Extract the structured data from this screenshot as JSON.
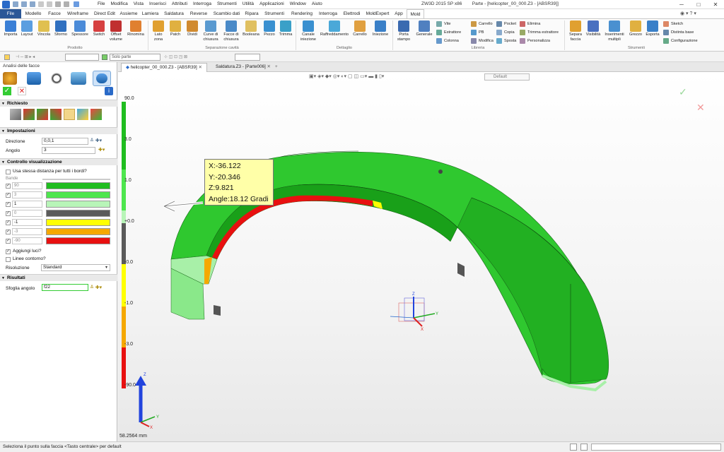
{
  "app": {
    "title": "ZW3D 2015 SP x86",
    "document": "Parte - [helicopter_00_000.Z3 - [ABSR39]]"
  },
  "menu": [
    "File",
    "Modifica",
    "Vista",
    "Inserisci",
    "Attributi",
    "Interroga",
    "Strumenti",
    "Utilità",
    "Applicazioni",
    "Window",
    "Aiuto"
  ],
  "tabs": [
    "File",
    "Modello",
    "Facce",
    "Wireframe",
    "Direct Edit",
    "Assieme",
    "Lamiera",
    "Saldatura",
    "Reverse",
    "Scambio dati",
    "Ripara",
    "Strumenti",
    "Rendering",
    "Interroga",
    "Elettrodi",
    "MoldExpert",
    "App",
    "Mold"
  ],
  "ribbon": {
    "prodotto": [
      "Importa",
      "Layout",
      "Vincola",
      "Sformo",
      "Spessore",
      "Switch",
      "Offset volume",
      "Rinomina"
    ],
    "separazione": [
      "Lato zona",
      "Patch",
      "Dividi",
      "Curve di chiusura",
      "Facce di chiusura",
      "Booleana",
      "Pezzo",
      "Trimma"
    ],
    "dettaglio": [
      "Canale iniezione",
      "Raffreddamento",
      "Carrello",
      "Iniezione"
    ],
    "libreria_big": [
      "Porta stampo",
      "Generale"
    ],
    "libreria_small": [
      "Vite",
      "Estrattore",
      "Colonna",
      "Carrello",
      "PB",
      "Modifica",
      "Pocket",
      "Copia",
      "Sposta",
      "Elimina",
      "Trimma estrattore",
      "Personalizza"
    ],
    "strumenti_big": [
      "Separa faccia",
      "Visibilità",
      "Inserimenti multipli",
      "Grezzo",
      "Esporta"
    ],
    "strumenti_small": [
      "Sketch",
      "Distinta base",
      "Configurazione"
    ],
    "groups": [
      "Prodotto",
      "Separazione cavità",
      "Dettaglio",
      "Libreria",
      "Strumenti"
    ]
  },
  "toolbar": {
    "filter": "Solo parte"
  },
  "panel": {
    "title": "Analisi delle facce",
    "sections": {
      "required": "Richiesto",
      "settings": "Impostazioni",
      "display": "Controllo visualizzazione",
      "results": "Risultati"
    },
    "direction_label": "Direzione",
    "direction_value": "0,0,1",
    "angle_label": "Angolo",
    "angle_value": "3",
    "same_distance": "Usa stessa distanza per tutti i bordi?",
    "bands_label": "Bande",
    "bands": [
      {
        "value": "90",
        "color": "#1fbd1f"
      },
      {
        "value": "3",
        "color": "#4ee64e"
      },
      {
        "value": "1",
        "color": "#b8f5b8"
      },
      {
        "value": "0",
        "color": "#5a5a5a"
      },
      {
        "value": "-1",
        "color": "#ffff00"
      },
      {
        "value": "-3",
        "color": "#f5a800"
      },
      {
        "value": "-90",
        "color": "#e81010"
      }
    ],
    "add_lights": "Aggiungi luci?",
    "contour_lines": "Linee contorno?",
    "resolution_label": "Risoluzione",
    "resolution_value": "Standard",
    "sheet_angle_label": "Sfoglia angolo",
    "sheet_angle_value": "f22"
  },
  "doc_tabs": [
    "helicopter_00_000.Z3 - [ABSR39]",
    "Saldatura.Z3 - [Parte006]"
  ],
  "viewport": {
    "view_name": "Default",
    "tooltip": {
      "x": "X:-36.122",
      "y": "Y:-20.346",
      "z": "Z:9.821",
      "angle": "Angle:18.12 Gradi"
    },
    "legend": [
      "90.0",
      "3.0",
      "1.0",
      "+0.0",
      "-0.0",
      "-1.0",
      "-3.0",
      "-90.0"
    ],
    "scale": "58.2564 mm",
    "axis": {
      "x": "X",
      "y": "Y",
      "z": "Z"
    }
  },
  "status": "Seleziona il punto sulla faccia <Tasto centrale> per default"
}
